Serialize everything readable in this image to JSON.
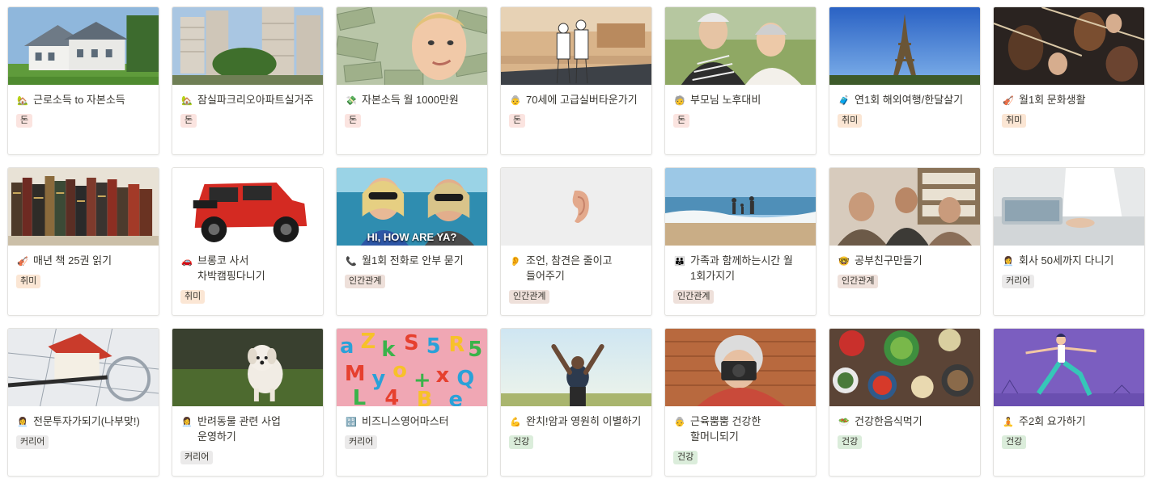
{
  "tag_colors": {
    "돈": "#fbe4e0",
    "취미": "#fbe6d4",
    "인간관계": "#eee0da",
    "커리어": "#ebeaea",
    "건강": "#dbeddb"
  },
  "cards": [
    {
      "emoji_icon": "house-with-garden-icon",
      "emoji": "🏡",
      "title": "근로소득 to 자본소득",
      "tag": "돈",
      "cover": "suburban-house-photo"
    },
    {
      "emoji_icon": "house-with-garden-icon",
      "emoji": "🏡",
      "title": "잠실파크리오아파트실거주",
      "tag": "돈",
      "cover": "apartment-towers-photo"
    },
    {
      "emoji_icon": "money-with-wings-icon",
      "emoji": "💸",
      "title": "자본소득 월 1000만원",
      "tag": "돈",
      "cover": "woman-in-dollar-bills-photo"
    },
    {
      "emoji_icon": "old-woman-icon",
      "emoji": "👵",
      "title": "70세에 고급실버타운가기",
      "tag": "돈",
      "cover": "silver-town-lobby-photo"
    },
    {
      "emoji_icon": "older-adult-icon",
      "emoji": "🧓",
      "title": "부모님 노후대비",
      "tag": "돈",
      "cover": "elderly-couple-photo"
    },
    {
      "emoji_icon": "luggage-icon",
      "emoji": "🧳",
      "title": "연1회 해외여행/한달살기",
      "tag": "취미",
      "cover": "eiffel-tower-photo"
    },
    {
      "emoji_icon": "violin-icon",
      "emoji": "🎻",
      "title": "월1회 문화생활",
      "tag": "취미",
      "cover": "orchestra-violins-photo"
    },
    {
      "emoji_icon": "violin-icon",
      "emoji": "🎻",
      "title": "매년 책 25권 읽기",
      "tag": "취미",
      "cover": "old-books-shelf-photo"
    },
    {
      "emoji_icon": "car-icon",
      "emoji": "🚗",
      "title": "브롱코 사서 차박캠핑다니기",
      "tag": "취미",
      "cover": "red-bronco-photo"
    },
    {
      "emoji_icon": "telephone-icon",
      "emoji": "📞",
      "title": "월1회 전화로 안부 묻기",
      "tag": "인간관계",
      "cover": "hi-how-are-ya-photo",
      "cover_caption": "HI, HOW ARE YA?"
    },
    {
      "emoji_icon": "ear-icon",
      "emoji": "👂",
      "title": "조언, 참견은 줄이고 들어주기",
      "tag": "인간관계",
      "cover": "ear-on-white-photo"
    },
    {
      "emoji_icon": "family-icon",
      "emoji": "👪",
      "title": "가족과 함께하는시간 월 1회가지기",
      "tag": "인간관계",
      "cover": "family-beach-photo"
    },
    {
      "emoji_icon": "nerd-face-icon",
      "emoji": "🤓",
      "title": "공부친구만들기",
      "tag": "인간관계",
      "cover": "friends-studying-photo"
    },
    {
      "emoji_icon": "office-worker-icon",
      "emoji": "👩‍💼",
      "title": "회사 50세까지 다니기",
      "tag": "커리어",
      "cover": "laptop-office-photo"
    },
    {
      "emoji_icon": "office-worker-icon",
      "emoji": "👩‍💼",
      "title": "전문투자가되기(나부맞!)",
      "tag": "커리어",
      "cover": "house-magnifier-photo"
    },
    {
      "emoji_icon": "office-worker-icon",
      "emoji": "👩‍💼",
      "title": "반려동물 관련 사업 운영하기",
      "tag": "커리어",
      "cover": "running-dog-photo"
    },
    {
      "emoji_icon": "abcd-icon",
      "emoji": "🔡",
      "title": "비즈니스영어마스터",
      "tag": "커리어",
      "cover": "colorful-letters-photo"
    },
    {
      "emoji_icon": "flexed-biceps-icon",
      "emoji": "💪",
      "title": "완치!암과 영원히 이별하기",
      "tag": "건강",
      "cover": "man-arms-raised-photo"
    },
    {
      "emoji_icon": "old-woman-icon",
      "emoji": "👵",
      "title": "근육뿜뿜 건강한 할머니되기",
      "tag": "건강",
      "cover": "grandma-camera-photo"
    },
    {
      "emoji_icon": "salad-icon",
      "emoji": "🥗",
      "title": "건강한음식먹기",
      "tag": "건강",
      "cover": "healthy-food-table-photo"
    },
    {
      "emoji_icon": "person-yoga-icon",
      "emoji": "🧘",
      "title": "주2회 요가하기",
      "tag": "건강",
      "cover": "yoga-illustration"
    }
  ]
}
